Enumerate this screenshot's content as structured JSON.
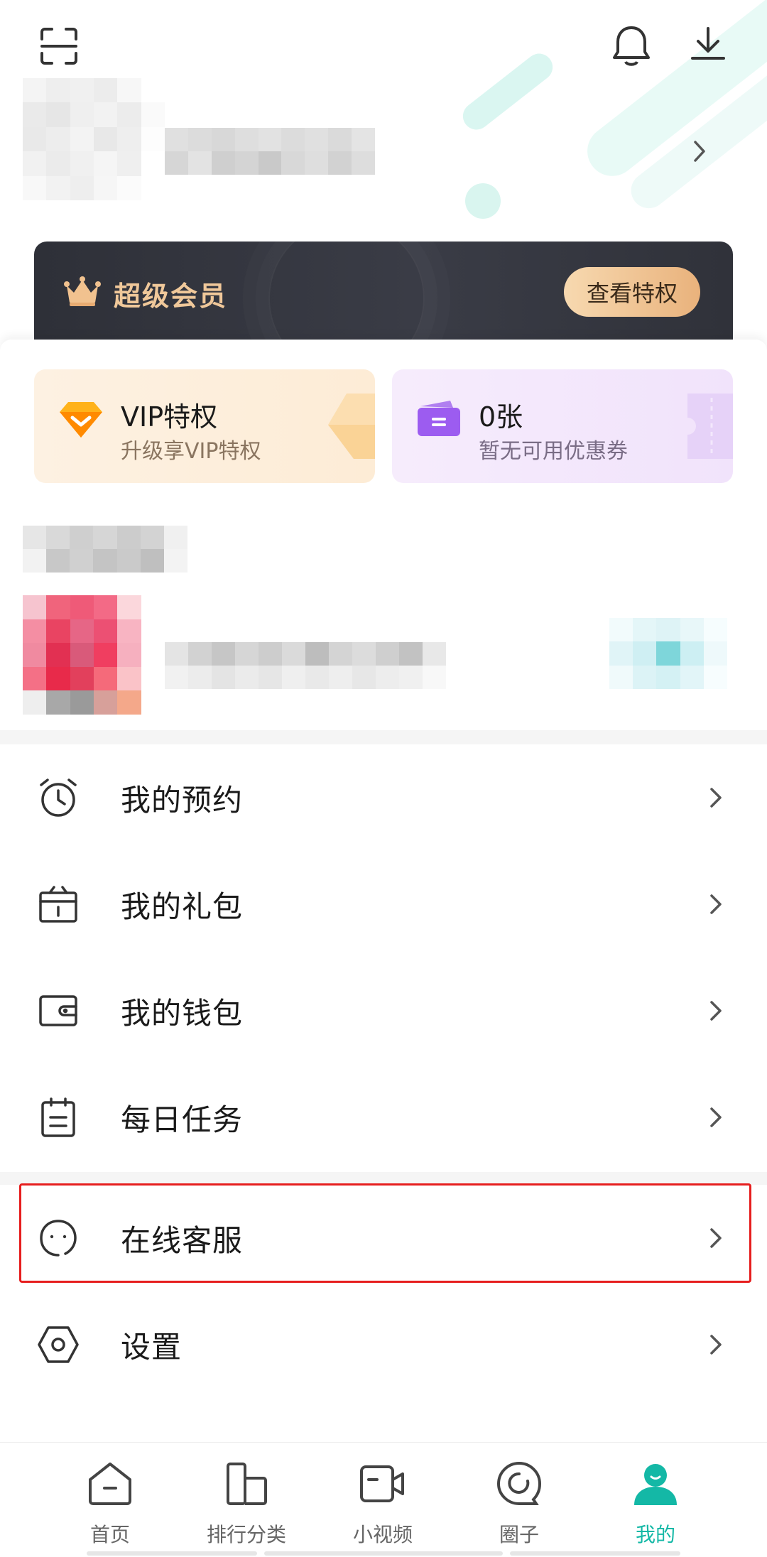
{
  "header": {
    "scan_icon": "scan-icon",
    "bell_icon": "bell-icon",
    "download_icon": "download-icon",
    "avatar_pixels": [
      "#f4f4f4",
      "#eeeeee",
      "#f0f0f0",
      "#ececec",
      "#f7f7f7",
      "#ffffff",
      "#eaeaea",
      "#e6e6e6",
      "#efefef",
      "#f2f2f2",
      "#ececec",
      "#fafafa",
      "#e9e9e9",
      "#ededed",
      "#f3f3f3",
      "#e8e8e8",
      "#eeeeee",
      "#fdfdfd",
      "#f1f1f1",
      "#ebebeb",
      "#f0f0f0",
      "#f5f5f5",
      "#efefef",
      "#ffffff",
      "#f8f8f8",
      "#f2f2f2",
      "#eeeeee",
      "#f6f6f6",
      "#fbfbfb",
      "#ffffff"
    ],
    "username_pixels": [
      "#e0e0e0",
      "#dcdcdc",
      "#d8d8d8",
      "#dedede",
      "#e2e2e2",
      "#dcdcdc",
      "#e0e0e0",
      "#dadada",
      "#e4e4e4",
      "#d6d6d6",
      "#e3e3e3",
      "#cfcfcf",
      "#d4d4d4",
      "#c9c9c9",
      "#d8d8d8",
      "#dedede",
      "#d2d2d2",
      "#dddddd"
    ]
  },
  "vip_banner": {
    "title": "超级会员",
    "button_label": "查看特权",
    "accent_color": "#f0c89a"
  },
  "cards": {
    "vip": {
      "title": "VIP特权",
      "subtitle": "升级享VIP特权"
    },
    "coupon": {
      "title": "0张",
      "subtitle": "暂无可用优惠券"
    }
  },
  "blurred": {
    "section_label": [
      "#e6e6e6",
      "#d9d9d9",
      "#cfcfcf",
      "#d6d6d6",
      "#cccccc",
      "#d3d3d3",
      "#f0f0f0",
      "#f2f2f2",
      "#c8c8c8",
      "#d0d0d0",
      "#c4c4c4",
      "#cacaca",
      "#bfbfbf",
      "#f3f3f3"
    ],
    "promo_image": [
      "#f6c4cf",
      "#f0647c",
      "#ef5a78",
      "#f36a86",
      "#fbd7dc",
      "#ffffff",
      "#f48ea3",
      "#e94462",
      "#e66686",
      "#ec5073",
      "#f8b4c2",
      "#ffffff",
      "#f08aa0",
      "#e23052",
      "#d95a7a",
      "#f03e60",
      "#f6b0bf",
      "#ffffff",
      "#f47086",
      "#e82a4a",
      "#e2405c",
      "#f56a7a",
      "#fac3c8",
      "#ffffff",
      "#eeeeee",
      "#a8a8a8",
      "#9a9a9a",
      "#d7a09a",
      "#f4a88a",
      "#ffffff"
    ],
    "promo_text": [
      "#e4e4e4",
      "#d2d2d2",
      "#c6c6c6",
      "#d6d6d6",
      "#cdcdcd",
      "#dadada",
      "#bdbdbd",
      "#d4d4d4",
      "#dcdcdc",
      "#cfcfcf",
      "#c2c2c2",
      "#e8e8e8",
      "#f1f1f1",
      "#ececec",
      "#e4e4e4",
      "#ebebeb",
      "#e6e6e6",
      "#efefef",
      "#e9e9e9",
      "#eeeeee",
      "#e7e7e7",
      "#ededed",
      "#f0f0f0",
      "#f8f8f8"
    ],
    "promo_badge": [
      "#f2fbfc",
      "#e4f6f8",
      "#def3f6",
      "#e8f7f9",
      "#f6fdfe",
      "#e0f4f7",
      "#cfeff3",
      "#7ed6da",
      "#cdeff3",
      "#eef9fb",
      "#f0fafb",
      "#dcf3f6",
      "#d4f1f4",
      "#e2f5f8",
      "#f7fdfe"
    ]
  },
  "menu": [
    {
      "label": "我的预约",
      "icon": "alarm-clock-icon"
    },
    {
      "label": "我的礼包",
      "icon": "gift-icon"
    },
    {
      "label": "我的钱包",
      "icon": "wallet-icon"
    },
    {
      "label": "每日任务",
      "icon": "task-list-icon"
    },
    {
      "label": "在线客服",
      "icon": "customer-service-icon"
    },
    {
      "label": "设置",
      "icon": "settings-hexagon-icon"
    }
  ],
  "tabs": [
    {
      "label": "首页",
      "icon": "home-icon",
      "active": false
    },
    {
      "label": "排行分类",
      "icon": "ranking-icon",
      "active": false
    },
    {
      "label": "小视频",
      "icon": "video-camera-icon",
      "active": false
    },
    {
      "label": "圈子",
      "icon": "circle-community-icon",
      "active": false
    },
    {
      "label": "我的",
      "icon": "profile-icon",
      "active": true
    }
  ],
  "colors": {
    "accent": "#14b8a6",
    "highlight": "#e61e1e"
  }
}
